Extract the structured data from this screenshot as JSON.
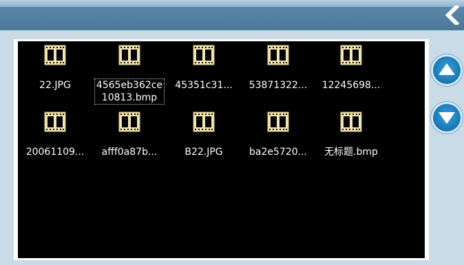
{
  "window": {
    "back_icon": "chevron-left-icon"
  },
  "colors": {
    "header": "#4c7897",
    "background": "#c9dbe6",
    "file_area": "#000000",
    "scroll_button": "#1a79b8"
  },
  "files": [
    {
      "name": "22.JPG",
      "icon": "film-icon"
    },
    {
      "name": "4565eb362ce10813.bmp",
      "icon": "film-icon",
      "selected": true
    },
    {
      "name": "45351c31...",
      "icon": "film-icon"
    },
    {
      "name": "53871322...",
      "icon": "film-icon"
    },
    {
      "name": "12245698...",
      "icon": "film-icon"
    },
    {
      "name": "20061109...",
      "icon": "film-icon"
    },
    {
      "name": "afff0a87b...",
      "icon": "film-icon"
    },
    {
      "name": "B22.JPG",
      "icon": "film-icon"
    },
    {
      "name": "ba2e5720...",
      "icon": "film-icon"
    },
    {
      "name": "无标题.bmp",
      "icon": "film-icon"
    }
  ],
  "scroll": {
    "up_icon": "arrow-up-icon",
    "down_icon": "arrow-down-icon"
  }
}
